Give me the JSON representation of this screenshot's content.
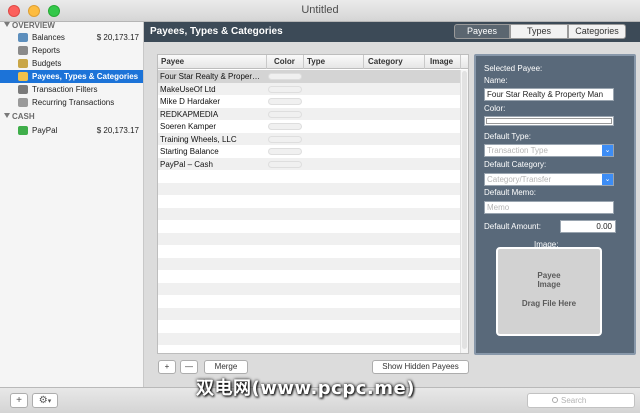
{
  "window": {
    "title": "Untitled"
  },
  "sidebar": {
    "overview_label": "OVERVIEW",
    "cash_label": "CASH",
    "items": [
      {
        "label": "Balances",
        "amount": "$ 20,173.17",
        "icon": "balances-icon",
        "color": "#5d8fbd"
      },
      {
        "label": "Reports",
        "amount": "",
        "icon": "reports-icon",
        "color": "#8a8a8a"
      },
      {
        "label": "Budgets",
        "amount": "",
        "icon": "budgets-icon",
        "color": "#c9a646"
      },
      {
        "label": "Payees, Types & Categories",
        "amount": "",
        "icon": "payees-icon",
        "color": "#f0c14b",
        "selected": true
      },
      {
        "label": "Transaction Filters",
        "amount": "",
        "icon": "filter-icon",
        "color": "#7a7a7a"
      },
      {
        "label": "Recurring Transactions",
        "amount": "",
        "icon": "recurring-icon",
        "color": "#9a9a9a"
      }
    ],
    "cash_items": [
      {
        "label": "PayPal",
        "amount": "$ 20,173.17",
        "icon": "paypal-icon",
        "color": "#3fae4a"
      }
    ]
  },
  "main": {
    "title": "Payees, Types & Categories",
    "tabs": [
      {
        "label": "Payees",
        "active": true
      },
      {
        "label": "Types",
        "active": false
      },
      {
        "label": "Categories",
        "active": false
      }
    ],
    "columns": [
      "Payee",
      "Color",
      "Type",
      "Category",
      "Image"
    ],
    "rows": [
      "Four Star Realty & Proper…",
      "MakeUseOf Ltd",
      "Mike D Hardaker",
      "REDKAPMEDIA",
      "Soeren Kamper",
      "Training Wheels, LLC",
      "Starting Balance",
      "PayPal – Cash"
    ],
    "add_label": "+",
    "remove_label": "—",
    "merge_label": "Merge",
    "show_hidden_label": "Show Hidden Payees"
  },
  "panel": {
    "heading": "Selected Payee:",
    "name_label": "Name:",
    "name_value": "Four Star Realty & Property Man",
    "color_label": "Color:",
    "default_type_label": "Default Type:",
    "type_placeholder": "Transaction Type",
    "default_category_label": "Default Category:",
    "category_placeholder": "Category/Transfer",
    "default_memo_label": "Default Memo:",
    "memo_placeholder": "Memo",
    "default_amount_label": "Default Amount:",
    "amount_value": "0.00",
    "image_label": "Image:",
    "drop_title": "Payee",
    "drop_subtitle": "Image",
    "drop_hint": "Drag File Here"
  },
  "bottombar": {
    "add_label": "+",
    "gear_label": "⚙",
    "search_placeholder": "Search"
  },
  "watermark": "双电网(www.pcpc.me)"
}
